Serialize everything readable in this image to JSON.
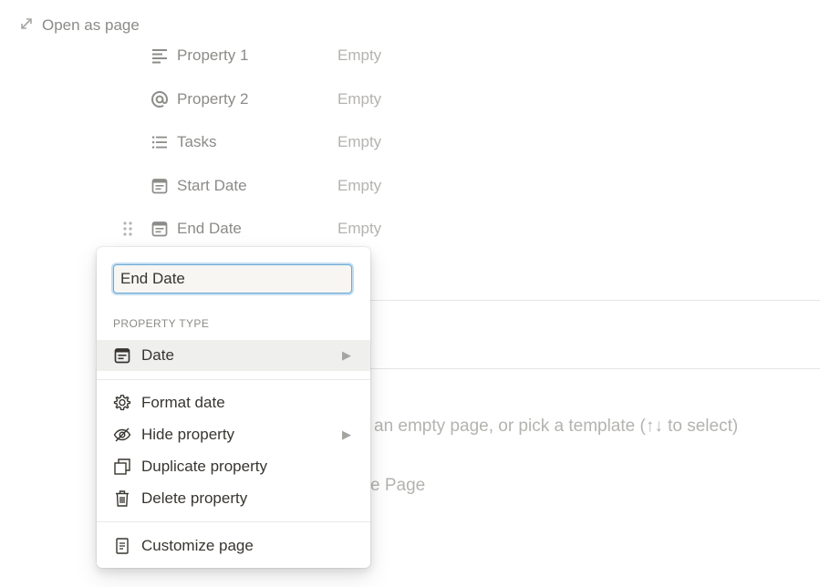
{
  "header": {
    "open_as_page": "Open as page"
  },
  "properties": [
    {
      "name": "Property 1",
      "value": "Empty",
      "icon": "text-lines-icon"
    },
    {
      "name": "Property 2",
      "value": "Empty",
      "icon": "at-sign-icon"
    },
    {
      "name": "Tasks",
      "value": "Empty",
      "icon": "list-icon"
    },
    {
      "name": "Start Date",
      "value": "Empty",
      "icon": "calendar-icon"
    },
    {
      "name": "End Date",
      "value": "Empty",
      "icon": "calendar-icon"
    }
  ],
  "background": {
    "hint_text": "an empty page, or pick a template (↑↓ to select)",
    "page_text": "e Page"
  },
  "menu": {
    "input_value": "End Date",
    "property_type_label": "PROPERTY TYPE",
    "type_value": "Date",
    "items": {
      "format_date": "Format date",
      "hide_property": "Hide property",
      "duplicate_property": "Duplicate property",
      "delete_property": "Delete property",
      "customize_page": "Customize page"
    }
  }
}
